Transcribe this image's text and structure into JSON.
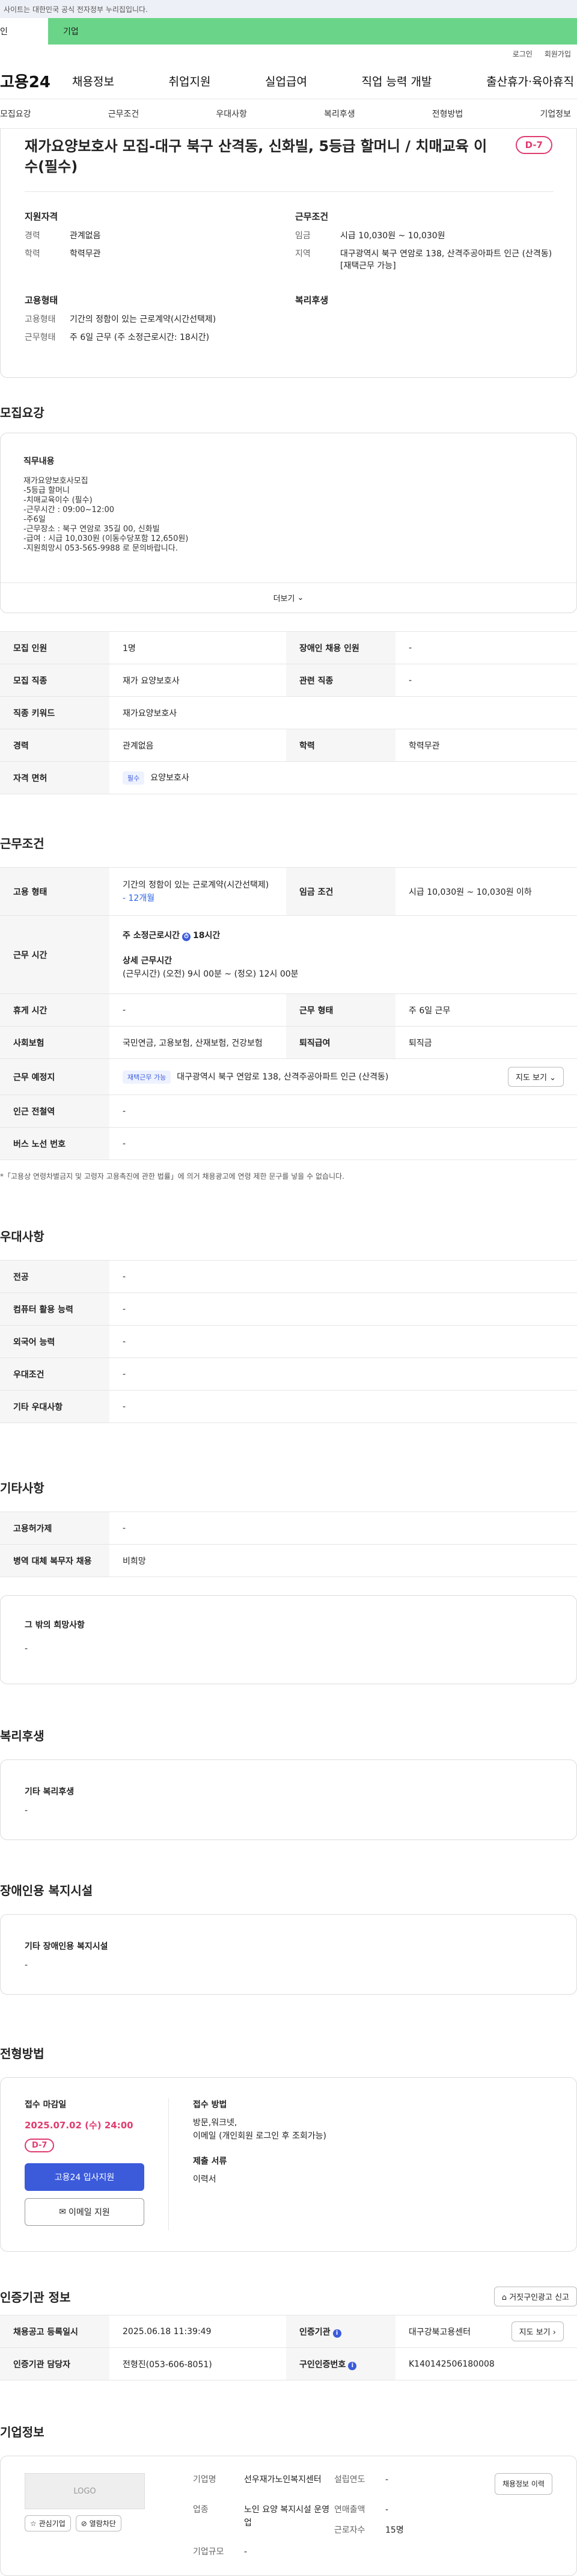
{
  "topbar": {
    "notice": "사이트는 대한민국 공식 전자정부 누리집입니다."
  },
  "usertabs": {
    "personal": "인",
    "corporate": "기업"
  },
  "util": {
    "login": "로그인",
    "signup": "회원가입"
  },
  "gnb": {
    "logo": "고용24",
    "menu": [
      "채용정보",
      "취업지원",
      "실업급여",
      "직업 능력 개발",
      "출산휴가·육아휴직"
    ]
  },
  "subtabs": [
    "모집요강",
    "근무조건",
    "우대사항",
    "복리후생",
    "전형방법",
    "기업정보"
  ],
  "job": {
    "title": "재가요양보호사 모집-대구 북구 산격동, 신화빌, 5등급 할머니 / 치매교육 이수(필수)",
    "dday": "D-7",
    "summary": {
      "qual_title": "지원자격",
      "career_k": "경력",
      "career_v": "관계없음",
      "edu_k": "학력",
      "edu_v": "학력무관",
      "cond_title": "근무조건",
      "wage_k": "임금",
      "wage_v": "시급 10,030원 ~ 10,030원",
      "loc_k": "지역",
      "loc_v": "대구광역시 북구 연암로 138, 산격주공아파트 인근 (산격동) [재택근무 가능]",
      "emp_title": "고용형태",
      "emptype_k": "고용형태",
      "emptype_v": "기간의 정함이 있는 근로계약(시간선택제)",
      "worktype_k": "근무형태",
      "worktype_v": "주 6일 근무 (주 소정근로시간: 18시간)",
      "welfare_title": "복리후생"
    }
  },
  "recruit": {
    "title": "모집요강",
    "duty_title": "직무내용",
    "duty_lines": [
      "재가요양보호사모집",
      "-5등급 할머니",
      "-치매교육이수 (필수)",
      "-근무시간 : 09:00~12:00",
      "-주6일",
      "-근무장소 : 북구 연암로 35길 00, 신화빌",
      "-급여 : 시급 10,030원 (이동수당포함 12,650원)",
      "-지원희망시 053-565-9988 로 문의바랍니다."
    ],
    "more": "더보기",
    "rows": [
      {
        "k1": "모집 인원",
        "v1": "1명",
        "k2": "장애인 채용 인원",
        "v2": "-"
      },
      {
        "k1": "모집 직종",
        "v1": "재가 요양보호사",
        "k2": "관련 직종",
        "v2": "-"
      },
      {
        "k1": "직종 키워드",
        "v1": "재가요양보호사"
      },
      {
        "k1": "경력",
        "v1": "관계없음",
        "k2": "학력",
        "v2": "학력무관"
      },
      {
        "k1": "자격 면허",
        "badge": "필수",
        "v1": "요양보호사"
      }
    ]
  },
  "work": {
    "title": "근무조건",
    "emp_k": "고용 형태",
    "emp_v": "기간의 정함이 있는 근로계약(시간선택제)",
    "emp_period": "12개월",
    "wage_k": "임금 조건",
    "wage_v": "시급 10,030원 ~ 10,030원 이하",
    "time_k": "근무 시간",
    "weekly": "주 소정근로시간",
    "weekly_hours": "18시간",
    "detail_title": "상세 근무시간",
    "detail_v": "(근무시간) (오전) 9시 00분 ~ (정오) 12시 00분",
    "rest_k": "휴게 시간",
    "rest_v": "-",
    "form_k": "근무 형태",
    "form_v": "주 6일 근무",
    "ins_k": "사회보험",
    "ins_v": "국민연금, 고용보험, 산재보험, 건강보험",
    "sev_k": "퇴직급여",
    "sev_v": "퇴직금",
    "place_k": "근무 예정지",
    "place_pill": "재택근무 가능",
    "place_v": "대구광역시 북구 연암로 138, 산격주공아파트 인근 (산격동)",
    "map_btn": "지도 보기",
    "station_k": "인근 전철역",
    "station_v": "-",
    "bus_k": "버스 노선 번호",
    "bus_v": "-",
    "footnote": "*「고용상 연령차별금지 및 고령자 고용촉진에 관한 법률」에 의거 채용광고에 연령 제한 문구를 넣을 수 없습니다."
  },
  "pref": {
    "title": "우대사항",
    "rows": [
      {
        "k": "전공",
        "v": "-"
      },
      {
        "k": "컴퓨터 활용 능력",
        "v": "-"
      },
      {
        "k": "외국어 능력",
        "v": "-"
      },
      {
        "k": "우대조건",
        "v": "-"
      },
      {
        "k": "기타 우대사항",
        "v": "-"
      }
    ]
  },
  "etc": {
    "title": "기타사항",
    "rows": [
      {
        "k": "고용허가제",
        "v": "-"
      },
      {
        "k": "병역 대체 복무자 채용",
        "v": "비희망"
      }
    ],
    "other_title": "그 밖의 희망사항",
    "other_v": "-"
  },
  "welfare": {
    "title": "복리후생",
    "sub": "기타 복리후생",
    "v": "-"
  },
  "disabled": {
    "title": "장애인용 복지시설",
    "sub": "기타 장애인용 복지시설",
    "v": "-"
  },
  "selection": {
    "title": "전형방법",
    "deadline_k": "접수 마감일",
    "deadline_v": "2025.07.02 (수) 24:00",
    "dday": "D-7",
    "apply_btn": "고용24 입사지원",
    "email_btn": "이메일 지원",
    "method_k": "접수 방법",
    "method_v": "방문,워크넷,",
    "method_v2": "이메일 (개인회원 로그인 후 조회가능)",
    "docs_k": "제출 서류",
    "docs_v": "이력서"
  },
  "agency": {
    "title": "인증기관 정보",
    "report_btn": "거짓구인광고 신고",
    "reg_k": "채용공고 등록일시",
    "reg_v": "2025.06.18 11:39:49",
    "org_k": "인증기관",
    "org_v": "대구강북고용센터",
    "map_btn": "지도 보기",
    "staff_k": "인증기관 담당자",
    "staff_v": "전형진(053-606-8051)",
    "num_k": "구인인증번호",
    "num_v": "K140142506180008"
  },
  "company": {
    "title": "기업정보",
    "logo": "LOGO",
    "fav_btn": "관심기업",
    "block_btn": "열람차단",
    "name_k": "기업명",
    "name_v": "선우재가노인복지센터",
    "founded_k": "설립연도",
    "founded_v": "-",
    "info_btn": "채용정보 이력",
    "industry_k": "업종",
    "industry_v": "노인 요양 복지시설 운영업",
    "sales_k": "연매출액",
    "sales_v": "-",
    "emp_k": "근로자수",
    "emp_v": "15명",
    "size_k": "기업규모",
    "size_v": "-"
  }
}
